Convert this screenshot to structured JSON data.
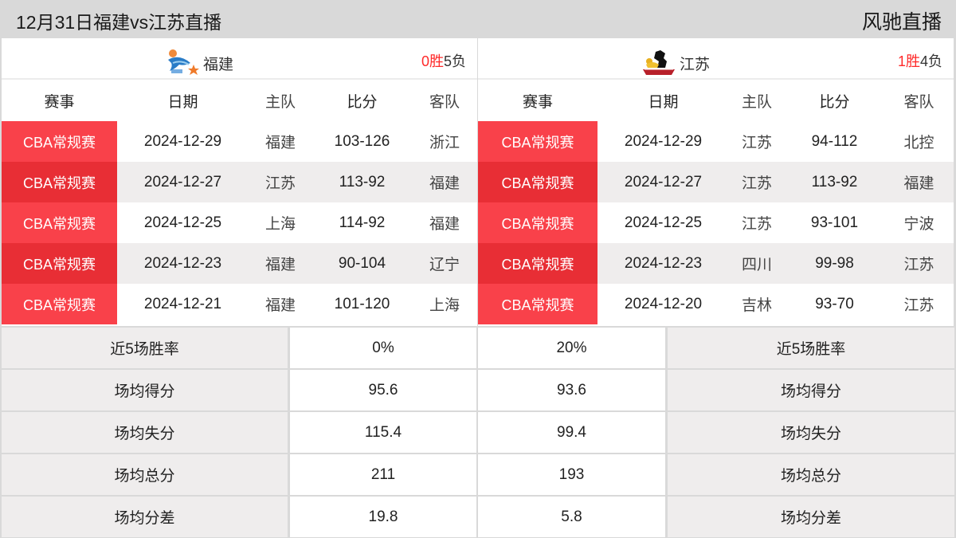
{
  "header": {
    "title": "12月31日福建vs江苏直播",
    "brand": "风驰直播"
  },
  "columns": {
    "event": "赛事",
    "date": "日期",
    "home": "主队",
    "score": "比分",
    "away": "客队"
  },
  "teams": [
    {
      "name": "福建",
      "logo_icon": "fujian-sturgeons-logo",
      "record": {
        "wins": "0",
        "win_label": "胜",
        "losses": "5",
        "loss_label": "负"
      },
      "matches": [
        {
          "event": "CBA常规赛",
          "date": "2024-12-29",
          "home": "福建",
          "score": "103-126",
          "away": "浙江"
        },
        {
          "event": "CBA常规赛",
          "date": "2024-12-27",
          "home": "江苏",
          "score": "113-92",
          "away": "福建"
        },
        {
          "event": "CBA常规赛",
          "date": "2024-12-25",
          "home": "上海",
          "score": "114-92",
          "away": "福建"
        },
        {
          "event": "CBA常规赛",
          "date": "2024-12-23",
          "home": "福建",
          "score": "90-104",
          "away": "辽宁"
        },
        {
          "event": "CBA常规赛",
          "date": "2024-12-21",
          "home": "福建",
          "score": "101-120",
          "away": "上海"
        }
      ]
    },
    {
      "name": "江苏",
      "logo_icon": "jiangsu-dragons-logo",
      "record": {
        "wins": "1",
        "win_label": "胜",
        "losses": "4",
        "loss_label": "负"
      },
      "matches": [
        {
          "event": "CBA常规赛",
          "date": "2024-12-29",
          "home": "江苏",
          "score": "94-112",
          "away": "北控"
        },
        {
          "event": "CBA常规赛",
          "date": "2024-12-27",
          "home": "江苏",
          "score": "113-92",
          "away": "福建"
        },
        {
          "event": "CBA常规赛",
          "date": "2024-12-25",
          "home": "江苏",
          "score": "93-101",
          "away": "宁波"
        },
        {
          "event": "CBA常规赛",
          "date": "2024-12-23",
          "home": "四川",
          "score": "99-98",
          "away": "江苏"
        },
        {
          "event": "CBA常规赛",
          "date": "2024-12-20",
          "home": "吉林",
          "score": "93-70",
          "away": "江苏"
        }
      ]
    }
  ],
  "stats": [
    {
      "label": "近5场胜率",
      "left": "0%",
      "right": "20%"
    },
    {
      "label": "场均得分",
      "left": "95.6",
      "right": "93.6"
    },
    {
      "label": "场均失分",
      "left": "115.4",
      "right": "99.4"
    },
    {
      "label": "场均总分",
      "left": "211",
      "right": "193"
    },
    {
      "label": "场均分差",
      "left": "19.8",
      "right": "5.8"
    }
  ],
  "colors": {
    "event_badge": "#f9414a",
    "event_badge_alt": "#e82e35",
    "win_count": "#ff2a2a",
    "header_bg": "#d9d9d9",
    "alt_row_bg": "#efeded"
  }
}
